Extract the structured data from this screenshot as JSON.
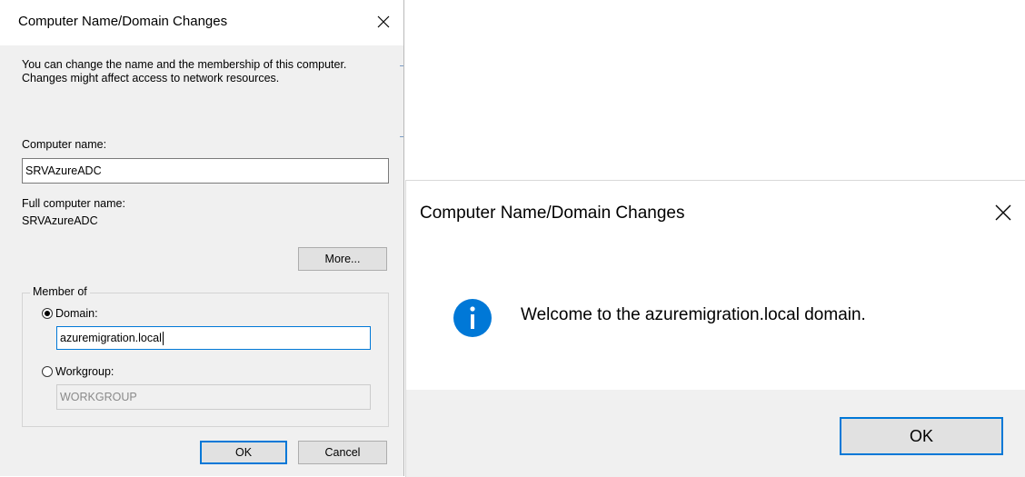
{
  "left_dialog": {
    "title": "Computer Name/Domain Changes",
    "description": "You can change the name and the membership of this computer. Changes might affect access to network resources.",
    "computer_name_label": "Computer name:",
    "computer_name_value": "SRVAzureADC",
    "full_name_label": "Full computer name:",
    "full_name_value": "SRVAzureADC",
    "more_button": "More...",
    "member_of_legend": "Member of",
    "domain_label": "Domain:",
    "domain_value": "azuremigration.local",
    "domain_selected": true,
    "workgroup_label": "Workgroup:",
    "workgroup_value": "WORKGROUP",
    "ok_button": "OK",
    "cancel_button": "Cancel"
  },
  "right_dialog": {
    "title": "Computer Name/Domain Changes",
    "message": "Welcome to the azuremigration.local domain.",
    "icon": "info-icon",
    "ok_button": "OK"
  },
  "colors": {
    "accent": "#0078d7",
    "dialog_bg": "#f0f0f0",
    "button_bg": "#e1e1e1"
  }
}
